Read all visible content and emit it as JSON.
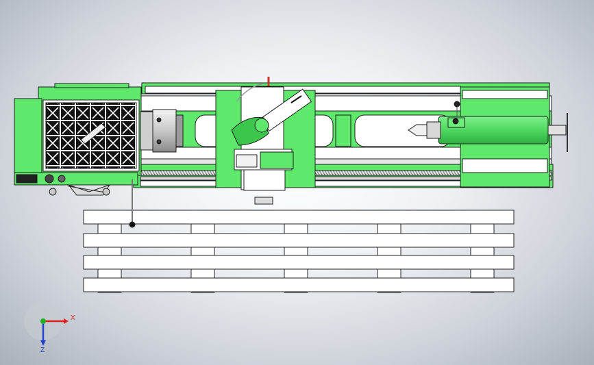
{
  "viewport": {
    "background_top": "#ffffff",
    "background_edge": "#aab0ba"
  },
  "model": {
    "body_color": "#5ee86c",
    "body_stroke": "#1c1c1c",
    "bed_color": "#ffffff",
    "trim_color": "#bfbfbf",
    "pallet_color": "#ffffff"
  },
  "triad": {
    "x_label": "X",
    "z_label": "Z",
    "x_color": "#e02020",
    "y_color": "#20b020",
    "z_color": "#2040d0"
  }
}
